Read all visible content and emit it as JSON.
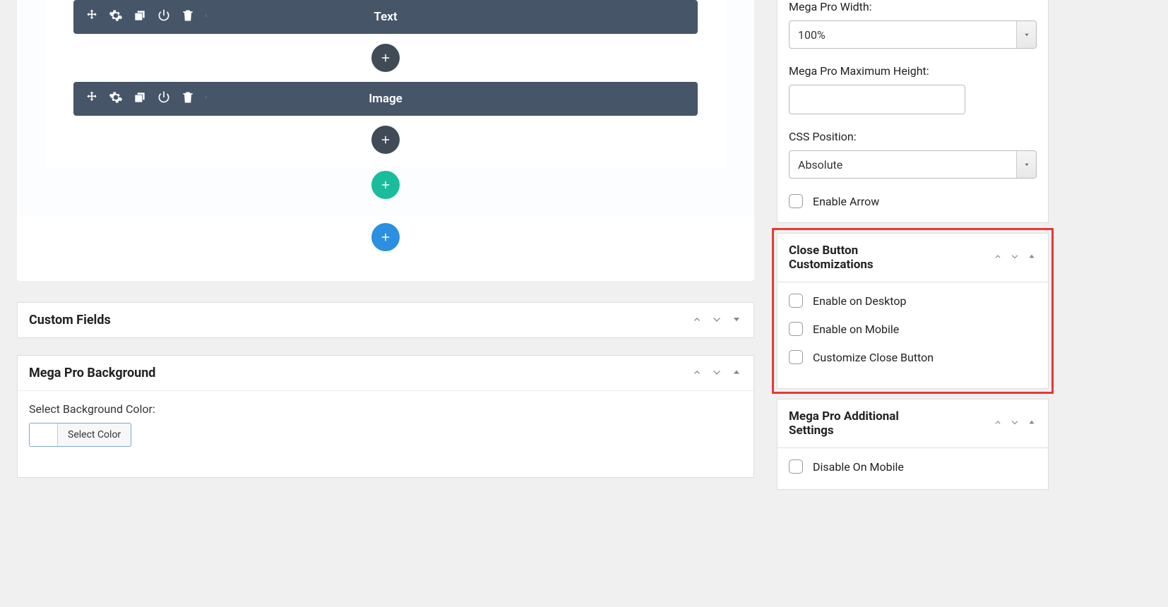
{
  "editor": {
    "widgets": [
      {
        "label": "Text"
      },
      {
        "label": "Image"
      }
    ]
  },
  "left_panels": {
    "custom_fields": {
      "title": "Custom Fields"
    },
    "mega_bg": {
      "title": "Mega Pro Background",
      "field_label": "Select Background Color:",
      "button_label": "Select Color"
    }
  },
  "sidebar": {
    "panel_top": {
      "width_label": "Mega Pro Width:",
      "width_value": "100%",
      "maxheight_label": "Mega Pro Maximum Height:",
      "maxheight_value": "",
      "cssposition_label": "CSS Position:",
      "cssposition_value": "Absolute",
      "enable_arrow_label": "Enable Arrow"
    },
    "close_btn": {
      "title": "Close Button Customizations",
      "opt1": "Enable on Desktop",
      "opt2": "Enable on Mobile",
      "opt3": "Customize Close Button"
    },
    "additional": {
      "title": "Mega Pro Additional Settings",
      "opt1": "Disable On Mobile"
    }
  }
}
